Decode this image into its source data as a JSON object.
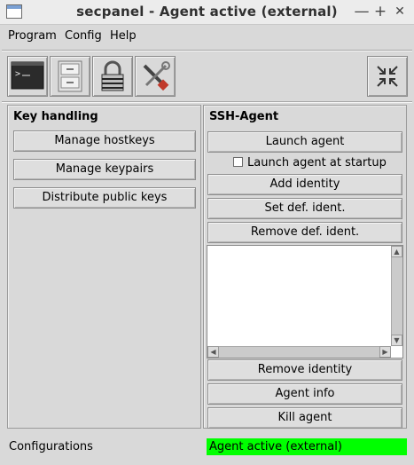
{
  "window": {
    "title": "secpanel - Agent active (external)",
    "app_icon": "window-app-icon",
    "controls": {
      "minimize": "—",
      "maximize": "+",
      "close": "✕"
    }
  },
  "menubar": {
    "items": [
      {
        "label": "Program"
      },
      {
        "label": "Config"
      },
      {
        "label": "Help"
      }
    ]
  },
  "toolbar": {
    "buttons": [
      {
        "icon": "terminal-icon"
      },
      {
        "icon": "file-cabinet-icon"
      },
      {
        "icon": "padlock-icon"
      },
      {
        "icon": "tools-icon"
      }
    ],
    "right_button": {
      "icon": "compress-arrows-icon"
    }
  },
  "key_handling": {
    "title": "Key handling",
    "buttons": [
      {
        "label": "Manage hostkeys"
      },
      {
        "label": "Manage keypairs"
      },
      {
        "label": "Distribute public keys"
      }
    ]
  },
  "ssh_agent": {
    "title": "SSH-Agent",
    "launch_label": "Launch agent",
    "startup_checkbox": {
      "label": "Launch agent at startup",
      "checked": false
    },
    "add_identity_label": "Add identity",
    "set_default_label": "Set def. ident.",
    "remove_default_label": "Remove def. ident.",
    "identities": [],
    "remove_identity_label": "Remove identity",
    "agent_info_label": "Agent info",
    "kill_agent_label": "Kill agent"
  },
  "status": {
    "left": "Configurations",
    "right": "Agent active (external)",
    "right_color": "#00ff00"
  }
}
